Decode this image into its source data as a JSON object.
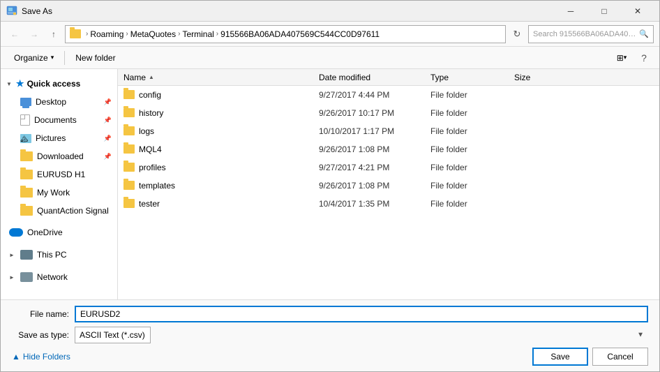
{
  "dialog": {
    "title": "Save As"
  },
  "titlebar": {
    "title": "Save As",
    "close_label": "✕",
    "minimize_label": "─",
    "maximize_label": "□"
  },
  "addressbar": {
    "back_disabled": true,
    "forward_disabled": true,
    "up_label": "↑",
    "path": "Roaming › MetaQuotes › Terminal › 915566BA06ADA407569C544CC0D97611",
    "path_parts": [
      "Roaming",
      "MetaQuotes",
      "Terminal",
      "915566BA06ADA407569C544CC0D97611"
    ],
    "search_placeholder": "Search 915566BA06ADA4075...",
    "refresh_label": "⟳"
  },
  "toolbar": {
    "organize_label": "Organize",
    "new_folder_label": "New folder",
    "view_label": "⊞",
    "view_dropdown": "▾",
    "help_label": "?"
  },
  "sidebar": {
    "quick_access_label": "Quick access",
    "desktop_label": "Desktop",
    "documents_label": "Documents",
    "pictures_label": "Pictures",
    "downloaded_label": "Downloaded",
    "eurusd_label": "EURUSD H1",
    "mywork_label": "My Work",
    "quantaction_label": "QuantAction Signal",
    "onedrive_label": "OneDrive",
    "thispc_label": "This PC",
    "network_label": "Network"
  },
  "filelist": {
    "columns": {
      "name": "Name",
      "date_modified": "Date modified",
      "type": "Type",
      "size": "Size"
    },
    "rows": [
      {
        "name": "config",
        "date": "9/27/2017 4:44 PM",
        "type": "File folder",
        "size": ""
      },
      {
        "name": "history",
        "date": "9/26/2017 10:17 PM",
        "type": "File folder",
        "size": ""
      },
      {
        "name": "logs",
        "date": "10/10/2017 1:17 PM",
        "type": "File folder",
        "size": ""
      },
      {
        "name": "MQL4",
        "date": "9/26/2017 1:08 PM",
        "type": "File folder",
        "size": ""
      },
      {
        "name": "profiles",
        "date": "9/27/2017 4:21 PM",
        "type": "File folder",
        "size": ""
      },
      {
        "name": "templates",
        "date": "9/26/2017 1:08 PM",
        "type": "File folder",
        "size": ""
      },
      {
        "name": "tester",
        "date": "10/4/2017 1:35 PM",
        "type": "File folder",
        "size": ""
      }
    ]
  },
  "bottombar": {
    "filename_label": "File name:",
    "filename_value": "EURUSD2",
    "savetype_label": "Save as type:",
    "savetype_value": "ASCII Text (*.csv)",
    "hide_folders_label": "Hide Folders",
    "save_label": "Save",
    "cancel_label": "Cancel"
  }
}
